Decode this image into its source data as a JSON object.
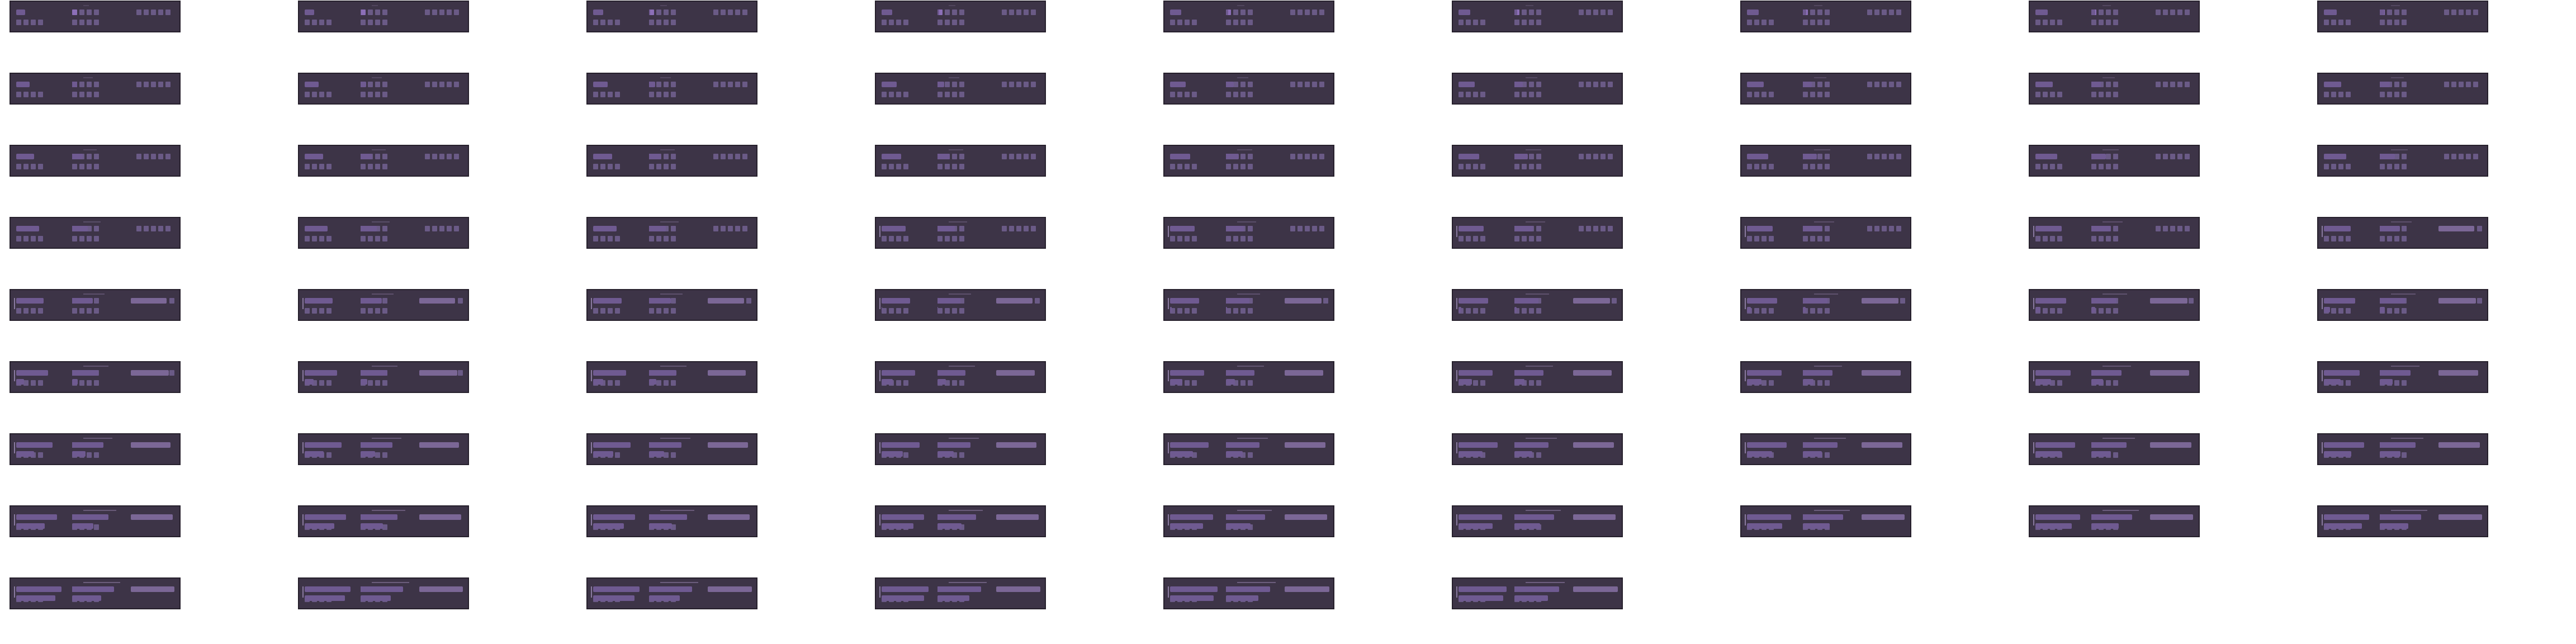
{
  "sheet": {
    "frame_count": 78,
    "columns": 9,
    "rows": 9,
    "last_row_frames": 6,
    "colors": {
      "background": "#ffffff",
      "frame_body": "#3d3447",
      "frame_border": "#26202c",
      "key": "#6a5a86",
      "key_highlight": "#8c6fb8",
      "bar": "#6f5a91",
      "strip": "#7b6796"
    }
  }
}
